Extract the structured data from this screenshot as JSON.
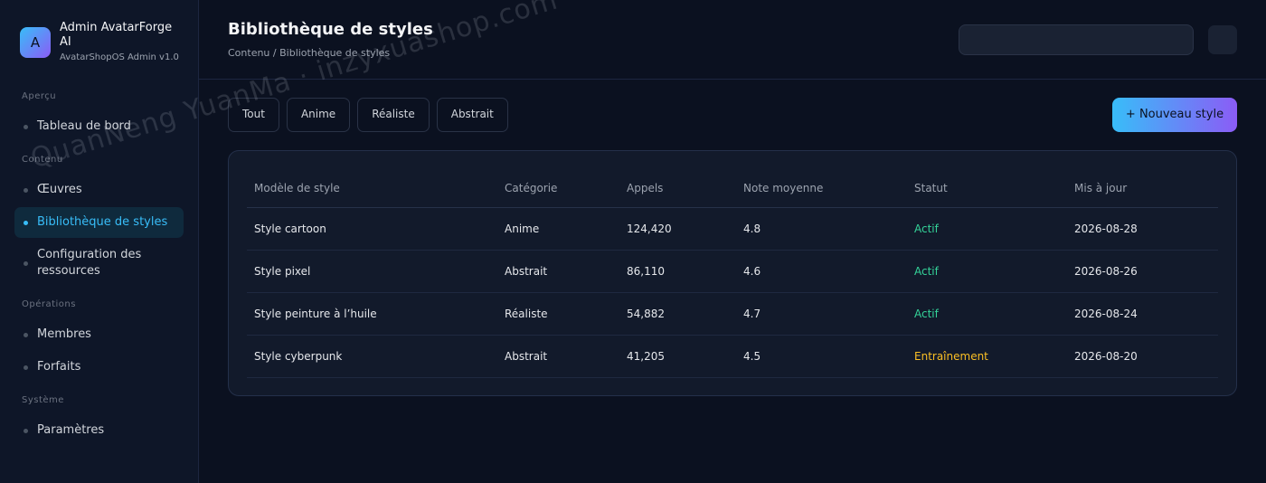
{
  "brand": {
    "logo_letter": "A",
    "title": "Admin AvatarForge AI",
    "subtitle": "AvatarShopOS Admin v1.0"
  },
  "sidebar": {
    "sections": [
      {
        "label": "Aperçu",
        "items": [
          {
            "label": "Tableau de bord"
          }
        ]
      },
      {
        "label": "Contenu",
        "items": [
          {
            "label": "Œuvres"
          },
          {
            "label": "Bibliothèque de styles",
            "active": true
          },
          {
            "label": "Configuration des ressources"
          }
        ]
      },
      {
        "label": "Opérations",
        "items": [
          {
            "label": "Membres"
          },
          {
            "label": "Forfaits"
          }
        ]
      },
      {
        "label": "Système",
        "items": [
          {
            "label": "Paramètres"
          }
        ]
      }
    ]
  },
  "header": {
    "title": "Bibliothèque de styles",
    "breadcrumb": "Contenu / Bibliothèque de styles"
  },
  "filters": [
    "Tout",
    "Anime",
    "Réaliste",
    "Abstrait"
  ],
  "new_button": "+ Nouveau style",
  "table": {
    "columns": [
      "Modèle de style",
      "Catégorie",
      "Appels",
      "Note moyenne",
      "Statut",
      "Mis à jour"
    ],
    "rows": [
      [
        "Style cartoon",
        "Anime",
        "124,420",
        "4.8",
        "Actif",
        "2026-08-28"
      ],
      [
        "Style pixel",
        "Abstrait",
        "86,110",
        "4.6",
        "Actif",
        "2026-08-26"
      ],
      [
        "Style peinture à l’huile",
        "Réaliste",
        "54,882",
        "4.7",
        "Actif",
        "2026-08-24"
      ],
      [
        "Style cyberpunk",
        "Abstrait",
        "41,205",
        "4.5",
        "Entraînement",
        "2026-08-20"
      ]
    ]
  },
  "watermark": "QuanNeng YuanMa · inzyxuashop.com",
  "colors": {
    "accent": "#38bdf8",
    "accent2": "#8b5cf6",
    "status_active": "#34d399",
    "status_training": "#fbbf24"
  }
}
